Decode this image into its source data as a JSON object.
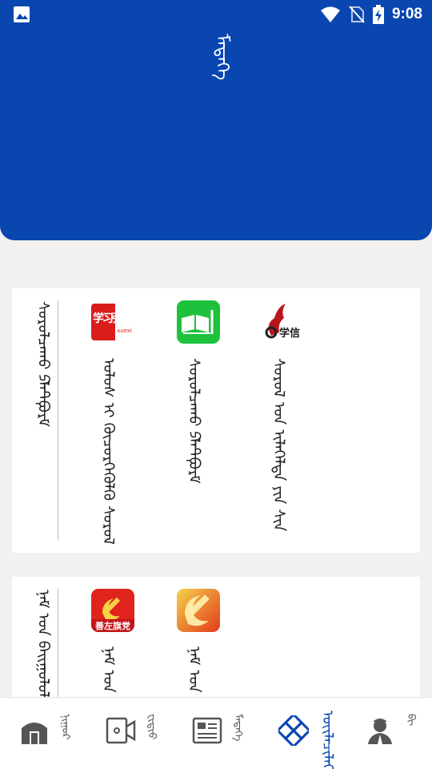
{
  "status_bar": {
    "time": "9:08",
    "icons": [
      "image-icon",
      "wifi-icon",
      "no-sim-icon",
      "battery-charging-icon"
    ]
  },
  "header": {
    "title": "ᠮᠡᠳᠡᠭᠡ"
  },
  "sections": [
    {
      "label": "ᠰᠤᠷᠤᠯᠴᠠᠬᠤ ᠫᠯᠠᠲᠹᠤᠷᠮ",
      "apps": [
        {
          "name": "ᠤᠯᠤᠰ ᠢ ᠬᠦᠴᠦᠷᠬᠡᠭᠦᠯᠬᠦ ᠰᠤᠷᠤᠯ",
          "icon": "xuexi-qiangguo-icon",
          "icon_text": "学习强国",
          "icon_subtext": "xuexi"
        },
        {
          "name": "ᠰᠤᠷᠤᠯᠴᠠᠬᠤ ᠫᠯᠠᠲᠹᠤᠷᠮ",
          "icon": "book-icon",
          "icon_text": ""
        },
        {
          "name": "ᠰᠤᠷᠤᠯ ᠤᠨ ᠢᠯᠡᠭᠡᠯᠲᠡ ᠶᠢᠨ ᠰᠢᠨ",
          "icon": "xuexin-icon",
          "icon_text": "学信"
        }
      ]
    },
    {
      "label": "ᠨᠠᠮ ᠤᠨ ᠪᠠᠢᠭᠤᠯᠤᠯᠭ᠎ᠠ",
      "apps": [
        {
          "name": "ᠨᠠᠮ ᠤᠨ ᠮᠡᠳᠡᠭᠡ",
          "icon": "party-emblem-icon",
          "icon_text": "善左旗党"
        },
        {
          "name": "ᠨᠠᠮ ᠤᠨ ᠪᠠᠢᠭᠤᠯᠤᠯᠭ᠎ᠠ",
          "icon": "party-emblem-large-icon",
          "icon_text": ""
        }
      ]
    }
  ],
  "tabbar": {
    "tabs": [
      {
        "label": "ᠨᠢᠭᠤᠷ",
        "icon": "yurt-icon"
      },
      {
        "label": "ᠸᠢᠳᠢᠤ",
        "icon": "video-camera-icon"
      },
      {
        "label": "ᠮᠡᠳᠡᠭᠡ",
        "icon": "news-card-icon"
      },
      {
        "label": "ᠦᠢᠯᠡᠴᠢᠯᠡᠭᠡ",
        "icon": "knot-pattern-icon"
      },
      {
        "label": "ᠪᠢ",
        "icon": "person-icon"
      }
    ],
    "active_index": 3
  },
  "colors": {
    "brand": "#0a46b0",
    "background": "#f2f1f0",
    "party_red": "#e0231c",
    "app_green": "#1ec13b"
  }
}
